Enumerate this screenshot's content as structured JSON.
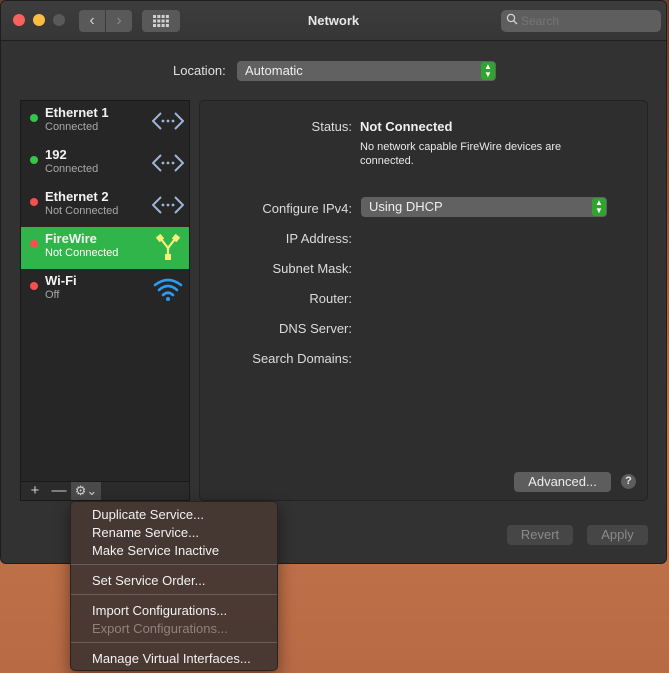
{
  "window": {
    "title": "Network",
    "search_placeholder": "Search",
    "nav_back": "‹",
    "nav_forward": "›",
    "show_all": "▦"
  },
  "location": {
    "label": "Location:",
    "value": "Automatic"
  },
  "services": [
    {
      "name": "Ethernet 1",
      "status": "Connected",
      "status_color": "#33c748",
      "icon": "ethernet-icon",
      "selected": false
    },
    {
      "name": "192",
      "status": "Connected",
      "status_color": "#33c748",
      "icon": "ethernet-icon",
      "selected": false
    },
    {
      "name": "Ethernet 2",
      "status": "Not Connected",
      "status_color": "#fb4f4f",
      "icon": "ethernet-icon",
      "selected": false
    },
    {
      "name": "FireWire",
      "status": "Not Connected",
      "status_color": "#fb4f4f",
      "icon": "firewire-icon",
      "selected": true
    },
    {
      "name": "Wi-Fi",
      "status": "Off",
      "status_color": "#fb4f4f",
      "icon": "wifi-icon",
      "selected": false
    }
  ],
  "sidebar_buttons": {
    "add": "+",
    "remove": "—",
    "gear": "⚙⌄"
  },
  "details": {
    "status_label": "Status:",
    "status_value": "Not Connected",
    "status_description": "No network capable FireWire devices are connected.",
    "configure_label": "Configure IPv4:",
    "configure_value": "Using DHCP",
    "ip_label": "IP Address:",
    "subnet_label": "Subnet Mask:",
    "router_label": "Router:",
    "dns_label": "DNS Server:",
    "search_domains_label": "Search Domains:",
    "advanced_button": "Advanced...",
    "help_button": "?"
  },
  "footer": {
    "revert": "Revert",
    "apply": "Apply"
  },
  "menu": {
    "duplicate": "Duplicate Service...",
    "rename": "Rename Service...",
    "make_inactive": "Make Service Inactive",
    "set_order": "Set Service Order...",
    "import": "Import Configurations...",
    "export": "Export Configurations...",
    "manage_virtual": "Manage Virtual Interfaces..."
  },
  "colors": {
    "accent_green": "#2fb54a",
    "connected": "#33c748",
    "disconnected": "#fb4f4f"
  }
}
